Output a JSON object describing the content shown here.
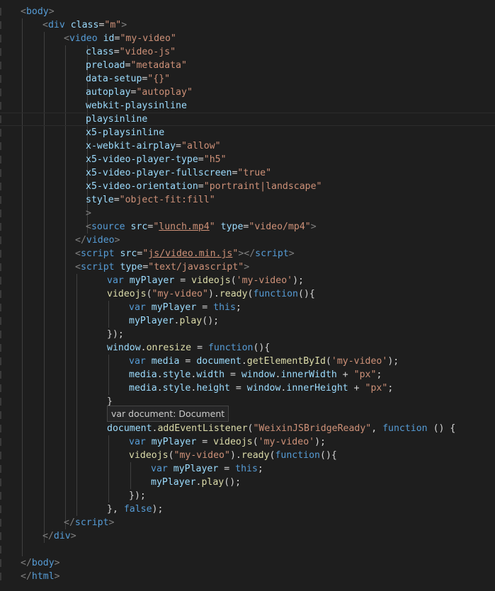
{
  "editor": {
    "tooltip": "var document: Document",
    "lines": [
      [
        {
          "t": "<",
          "c": "tag"
        },
        {
          "t": "body",
          "c": "tn"
        },
        {
          "t": ">",
          "c": "tag"
        }
      ],
      [
        {
          "t": "<",
          "c": "tag"
        },
        {
          "t": "div",
          "c": "tn"
        },
        {
          "t": " "
        },
        {
          "t": "class",
          "c": "at"
        },
        {
          "t": "=",
          "c": "eq"
        },
        {
          "t": "\"m\"",
          "c": "st"
        },
        {
          "t": ">",
          "c": "tag"
        }
      ],
      [
        {
          "t": "<",
          "c": "tag"
        },
        {
          "t": "video",
          "c": "tn"
        },
        {
          "t": " "
        },
        {
          "t": "id",
          "c": "at"
        },
        {
          "t": "=",
          "c": "eq"
        },
        {
          "t": "\"my-video\"",
          "c": "st"
        }
      ],
      [
        {
          "t": "class",
          "c": "at"
        },
        {
          "t": "=",
          "c": "eq"
        },
        {
          "t": "\"video-js\"",
          "c": "st"
        }
      ],
      [
        {
          "t": "preload",
          "c": "at"
        },
        {
          "t": "=",
          "c": "eq"
        },
        {
          "t": "\"metadata\"",
          "c": "st"
        }
      ],
      [
        {
          "t": "data-setup",
          "c": "at"
        },
        {
          "t": "=",
          "c": "eq"
        },
        {
          "t": "\"{}\"",
          "c": "st"
        }
      ],
      [
        {
          "t": "autoplay",
          "c": "at"
        },
        {
          "t": "=",
          "c": "eq"
        },
        {
          "t": "\"autoplay\"",
          "c": "st"
        }
      ],
      [
        {
          "t": "webkit-playsinline",
          "c": "at"
        }
      ],
      [
        {
          "t": "playsinline",
          "c": "at"
        }
      ],
      [
        {
          "t": "x5-playsinline",
          "c": "at"
        }
      ],
      [
        {
          "t": "x-webkit-airplay",
          "c": "at"
        },
        {
          "t": "=",
          "c": "eq"
        },
        {
          "t": "\"allow\"",
          "c": "st"
        }
      ],
      [
        {
          "t": "x5-video-player-type",
          "c": "at"
        },
        {
          "t": "=",
          "c": "eq"
        },
        {
          "t": "\"h5\"",
          "c": "st"
        }
      ],
      [
        {
          "t": "x5-video-player-fullscreen",
          "c": "at"
        },
        {
          "t": "=",
          "c": "eq"
        },
        {
          "t": "\"true\"",
          "c": "st"
        }
      ],
      [
        {
          "t": "x5-video-orientation",
          "c": "at"
        },
        {
          "t": "=",
          "c": "eq"
        },
        {
          "t": "\"portraint|landscape\"",
          "c": "st"
        }
      ],
      [
        {
          "t": "style",
          "c": "at"
        },
        {
          "t": "=",
          "c": "eq"
        },
        {
          "t": "\"object-fit:fill\"",
          "c": "st"
        }
      ],
      [
        {
          "t": ">",
          "c": "tag"
        }
      ],
      [
        {
          "t": "<",
          "c": "tag"
        },
        {
          "t": "source",
          "c": "tn"
        },
        {
          "t": " "
        },
        {
          "t": "src",
          "c": "at"
        },
        {
          "t": "=",
          "c": "eq"
        },
        {
          "t": "\"",
          "c": "st"
        },
        {
          "t": "lunch.mp4",
          "c": "st ul"
        },
        {
          "t": "\"",
          "c": "st"
        },
        {
          "t": " "
        },
        {
          "t": "type",
          "c": "at"
        },
        {
          "t": "=",
          "c": "eq"
        },
        {
          "t": "\"video/mp4\"",
          "c": "st"
        },
        {
          "t": ">",
          "c": "tag"
        }
      ],
      [
        {
          "t": "</",
          "c": "tag"
        },
        {
          "t": "video",
          "c": "tn"
        },
        {
          "t": ">",
          "c": "tag"
        }
      ],
      [
        {
          "t": "<",
          "c": "tag"
        },
        {
          "t": "script",
          "c": "tn"
        },
        {
          "t": " "
        },
        {
          "t": "src",
          "c": "at"
        },
        {
          "t": "=",
          "c": "eq"
        },
        {
          "t": "\"",
          "c": "st"
        },
        {
          "t": "js/video.min.js",
          "c": "st ul"
        },
        {
          "t": "\"",
          "c": "st"
        },
        {
          "t": "></",
          "c": "tag"
        },
        {
          "t": "script",
          "c": "tn"
        },
        {
          "t": ">",
          "c": "tag"
        }
      ],
      [
        {
          "t": "<",
          "c": "tag"
        },
        {
          "t": "script",
          "c": "tn"
        },
        {
          "t": " "
        },
        {
          "t": "type",
          "c": "at"
        },
        {
          "t": "=",
          "c": "eq"
        },
        {
          "t": "\"text/javascript\"",
          "c": "st"
        },
        {
          "t": ">",
          "c": "tag"
        }
      ],
      [
        {
          "t": "var",
          "c": "kw"
        },
        {
          "t": " "
        },
        {
          "t": "myPlayer",
          "c": "vr"
        },
        {
          "t": " = ",
          "c": "pu"
        },
        {
          "t": "videojs",
          "c": "fn"
        },
        {
          "t": "(",
          "c": "pu"
        },
        {
          "t": "'my-video'",
          "c": "st"
        },
        {
          "t": ");",
          "c": "pu"
        }
      ],
      [
        {
          "t": "videojs",
          "c": "fn"
        },
        {
          "t": "(",
          "c": "pu"
        },
        {
          "t": "\"my-video\"",
          "c": "st"
        },
        {
          "t": ").",
          "c": "pu"
        },
        {
          "t": "ready",
          "c": "fn"
        },
        {
          "t": "(",
          "c": "pu"
        },
        {
          "t": "function",
          "c": "kw"
        },
        {
          "t": "(){",
          "c": "pu"
        }
      ],
      [
        {
          "t": "var",
          "c": "kw"
        },
        {
          "t": " "
        },
        {
          "t": "myPlayer",
          "c": "vr"
        },
        {
          "t": " = ",
          "c": "pu"
        },
        {
          "t": "this",
          "c": "kw"
        },
        {
          "t": ";",
          "c": "pu"
        }
      ],
      [
        {
          "t": "myPlayer",
          "c": "vr"
        },
        {
          "t": ".",
          "c": "pu"
        },
        {
          "t": "play",
          "c": "fn"
        },
        {
          "t": "();",
          "c": "pu"
        }
      ],
      [
        {
          "t": "});",
          "c": "pu"
        }
      ],
      [
        {
          "t": "window",
          "c": "vr"
        },
        {
          "t": ".",
          "c": "pu"
        },
        {
          "t": "onresize",
          "c": "fn"
        },
        {
          "t": " = ",
          "c": "pu"
        },
        {
          "t": "function",
          "c": "kw"
        },
        {
          "t": "(){",
          "c": "pu"
        }
      ],
      [
        {
          "t": "var",
          "c": "kw"
        },
        {
          "t": " "
        },
        {
          "t": "media",
          "c": "vr"
        },
        {
          "t": " = ",
          "c": "pu"
        },
        {
          "t": "document",
          "c": "vr"
        },
        {
          "t": ".",
          "c": "pu"
        },
        {
          "t": "getElementById",
          "c": "fn"
        },
        {
          "t": "(",
          "c": "pu"
        },
        {
          "t": "'my-video'",
          "c": "st"
        },
        {
          "t": ");",
          "c": "pu"
        }
      ],
      [
        {
          "t": "media",
          "c": "vr"
        },
        {
          "t": ".",
          "c": "pu"
        },
        {
          "t": "style",
          "c": "vr"
        },
        {
          "t": ".",
          "c": "pu"
        },
        {
          "t": "width",
          "c": "vr"
        },
        {
          "t": " = ",
          "c": "pu"
        },
        {
          "t": "window",
          "c": "vr"
        },
        {
          "t": ".",
          "c": "pu"
        },
        {
          "t": "innerWidth",
          "c": "vr"
        },
        {
          "t": " + ",
          "c": "pu"
        },
        {
          "t": "\"px\"",
          "c": "st"
        },
        {
          "t": ";",
          "c": "pu"
        }
      ],
      [
        {
          "t": "media",
          "c": "vr"
        },
        {
          "t": ".",
          "c": "pu"
        },
        {
          "t": "style",
          "c": "vr"
        },
        {
          "t": ".",
          "c": "pu"
        },
        {
          "t": "height",
          "c": "vr"
        },
        {
          "t": " = ",
          "c": "pu"
        },
        {
          "t": "window",
          "c": "vr"
        },
        {
          "t": ".",
          "c": "pu"
        },
        {
          "t": "innerHeight",
          "c": "vr"
        },
        {
          "t": " + ",
          "c": "pu"
        },
        {
          "t": "\"px\"",
          "c": "st"
        },
        {
          "t": ";",
          "c": "pu"
        }
      ],
      [
        {
          "t": "}",
          "c": "pu"
        }
      ],
      [],
      [
        {
          "t": "document",
          "c": "vr"
        },
        {
          "t": ".",
          "c": "pu"
        },
        {
          "t": "addEventListener",
          "c": "fn"
        },
        {
          "t": "(",
          "c": "pu"
        },
        {
          "t": "\"WeixinJSBridgeReady\"",
          "c": "st"
        },
        {
          "t": ", ",
          "c": "pu"
        },
        {
          "t": "function",
          "c": "kw"
        },
        {
          "t": " () {",
          "c": "pu"
        }
      ],
      [
        {
          "t": "var",
          "c": "kw"
        },
        {
          "t": " "
        },
        {
          "t": "myPlayer",
          "c": "vr"
        },
        {
          "t": " = ",
          "c": "pu"
        },
        {
          "t": "videojs",
          "c": "fn"
        },
        {
          "t": "(",
          "c": "pu"
        },
        {
          "t": "'my-video'",
          "c": "st"
        },
        {
          "t": ");",
          "c": "pu"
        }
      ],
      [
        {
          "t": "videojs",
          "c": "fn"
        },
        {
          "t": "(",
          "c": "pu"
        },
        {
          "t": "\"my-video\"",
          "c": "st"
        },
        {
          "t": ").",
          "c": "pu"
        },
        {
          "t": "ready",
          "c": "fn"
        },
        {
          "t": "(",
          "c": "pu"
        },
        {
          "t": "function",
          "c": "kw"
        },
        {
          "t": "(){",
          "c": "pu"
        }
      ],
      [
        {
          "t": "var",
          "c": "kw"
        },
        {
          "t": " "
        },
        {
          "t": "myPlayer",
          "c": "vr"
        },
        {
          "t": " = ",
          "c": "pu"
        },
        {
          "t": "this",
          "c": "kw"
        },
        {
          "t": ";",
          "c": "pu"
        }
      ],
      [
        {
          "t": "myPlayer",
          "c": "vr"
        },
        {
          "t": ".",
          "c": "pu"
        },
        {
          "t": "play",
          "c": "fn"
        },
        {
          "t": "();",
          "c": "pu"
        }
      ],
      [
        {
          "t": "});",
          "c": "pu"
        }
      ],
      [
        {
          "t": "}, ",
          "c": "pu"
        },
        {
          "t": "false",
          "c": "kw"
        },
        {
          "t": ");",
          "c": "pu"
        }
      ],
      [
        {
          "t": "</",
          "c": "tag"
        },
        {
          "t": "script",
          "c": "tn"
        },
        {
          "t": ">",
          "c": "tag"
        }
      ],
      [
        {
          "t": "</",
          "c": "tag"
        },
        {
          "t": "div",
          "c": "tn"
        },
        {
          "t": ">",
          "c": "tag"
        }
      ],
      [],
      [
        {
          "t": "</",
          "c": "tag"
        },
        {
          "t": "body",
          "c": "tn"
        },
        {
          "t": ">",
          "c": "tag"
        }
      ],
      [
        {
          "t": "</",
          "c": "tag"
        },
        {
          "t": "html",
          "c": "tn"
        },
        {
          "t": ">",
          "c": "tag"
        }
      ]
    ]
  }
}
